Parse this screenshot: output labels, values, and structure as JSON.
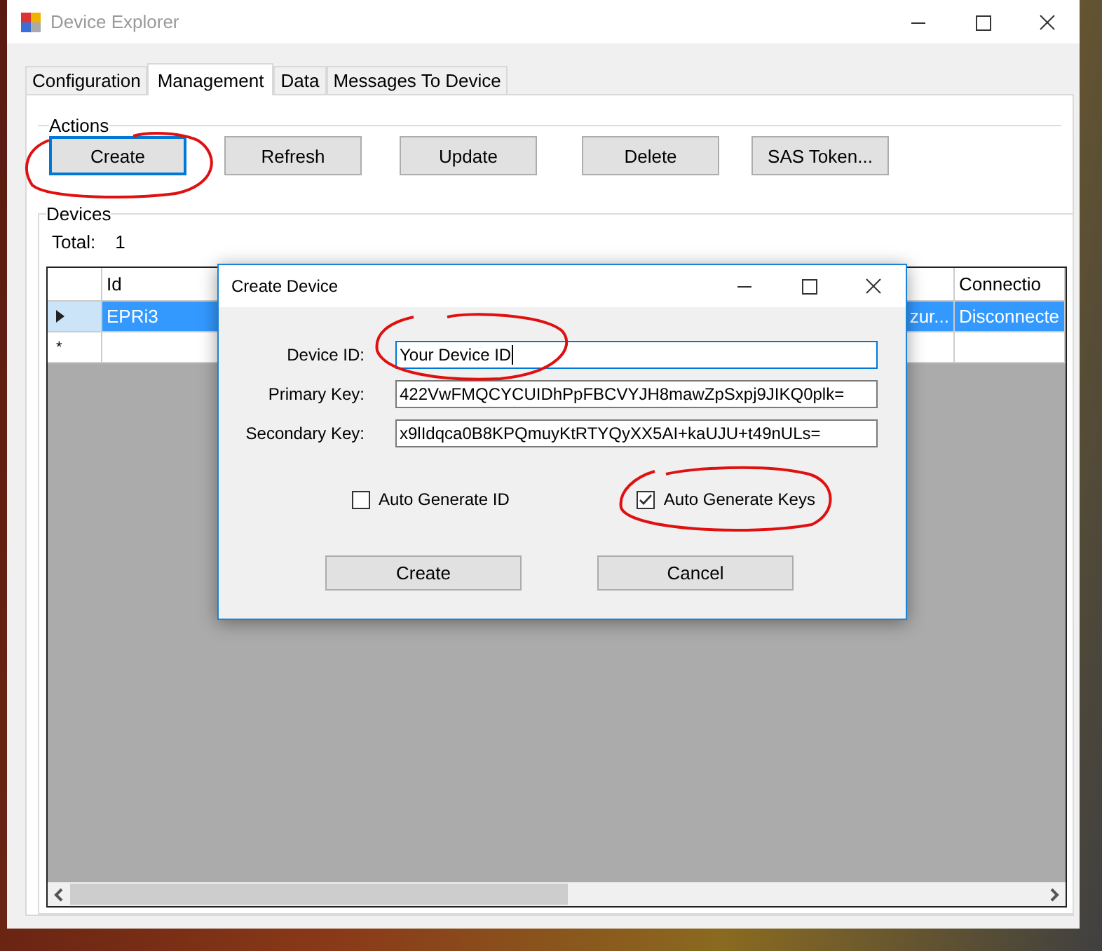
{
  "window": {
    "title": "Device Explorer"
  },
  "tabs": [
    {
      "label": "Configuration",
      "selected": false
    },
    {
      "label": "Management",
      "selected": true
    },
    {
      "label": "Data",
      "selected": false
    },
    {
      "label": "Messages To Device",
      "selected": false
    }
  ],
  "actions": {
    "title": "Actions",
    "buttons": [
      {
        "label": "Create",
        "focused": true
      },
      {
        "label": "Refresh",
        "focused": false
      },
      {
        "label": "Update",
        "focused": false
      },
      {
        "label": "Delete",
        "focused": false
      },
      {
        "label": "SAS Token...",
        "focused": false
      }
    ]
  },
  "devices": {
    "title": "Devices",
    "total_label": "Total:",
    "total": "1",
    "columns": {
      "id": "Id",
      "connection": "Connectio"
    },
    "rows": [
      {
        "selected": true,
        "id": "EPRi3",
        "column_3": "zur...",
        "connection": "Disconnecte"
      }
    ],
    "new_row": {
      "marker": "*"
    }
  },
  "dialog": {
    "title": "Create Device",
    "fields": [
      {
        "label": "Device ID:",
        "value": "Your Device ID",
        "focused": true
      },
      {
        "label": "Primary Key:",
        "value": "422VwFMQCYCUIDhPpFBCVYJH8mawZpSxpj9JIKQ0plk=",
        "focused": false
      },
      {
        "label": "Secondary Key:",
        "value": "x9lIdqca0B8KPQmuyKtRTYQyXX5AI+kaUJU+t49nULs=",
        "focused": false
      }
    ],
    "checkboxes": [
      {
        "label": "Auto Generate ID",
        "checked": false
      },
      {
        "label": "Auto Generate Keys",
        "checked": true
      }
    ],
    "buttons": [
      "Create",
      "Cancel"
    ]
  }
}
